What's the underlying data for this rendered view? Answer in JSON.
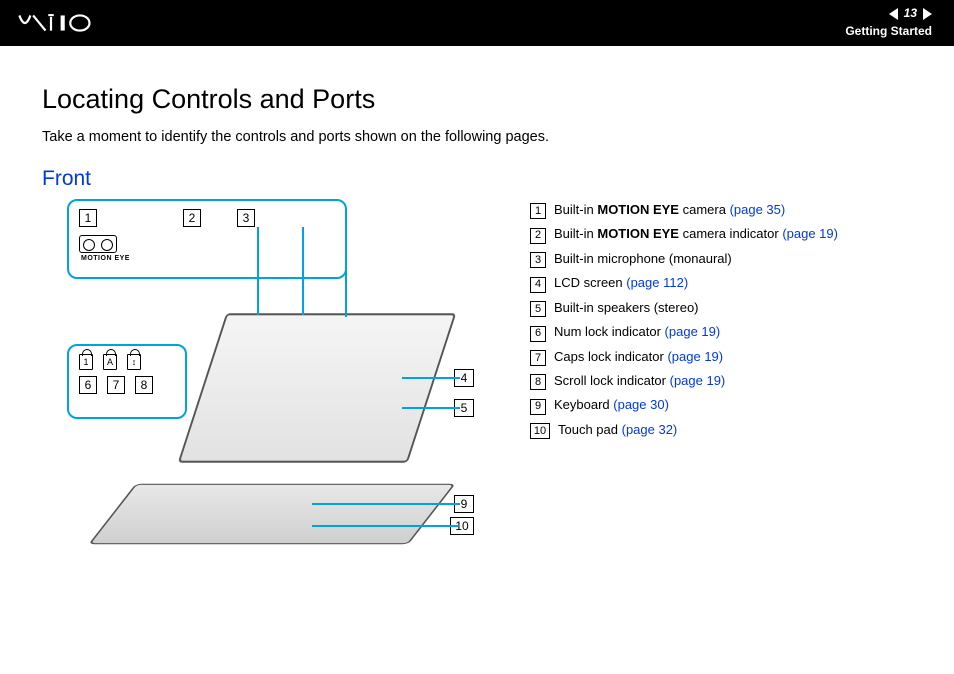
{
  "header": {
    "page_number": "13",
    "section": "Getting Started"
  },
  "title": "Locating Controls and Ports",
  "intro": "Take a moment to identify the controls and ports shown on the following pages.",
  "subheading": "Front",
  "diagram": {
    "callout_a_numbers": [
      "1",
      "2",
      "3"
    ],
    "motion_eye_label": "MOTION EYE",
    "callout_b_locks": [
      "1",
      "A",
      "↕"
    ],
    "callout_b_numbers": [
      "6",
      "7",
      "8"
    ],
    "side_numbers": {
      "n4": "4",
      "n5": "5",
      "n9": "9",
      "n10": "10"
    }
  },
  "legend": [
    {
      "num": "1",
      "prefix": "Built-in ",
      "bold": "MOTION EYE",
      "suffix": " camera ",
      "link": "(page 35)"
    },
    {
      "num": "2",
      "prefix": "Built-in ",
      "bold": "MOTION EYE",
      "suffix": " camera indicator ",
      "link": "(page 19)"
    },
    {
      "num": "3",
      "prefix": "Built-in microphone (monaural)",
      "bold": "",
      "suffix": "",
      "link": ""
    },
    {
      "num": "4",
      "prefix": "LCD screen ",
      "bold": "",
      "suffix": "",
      "link": "(page 112)"
    },
    {
      "num": "5",
      "prefix": "Built-in speakers (stereo)",
      "bold": "",
      "suffix": "",
      "link": ""
    },
    {
      "num": "6",
      "prefix": "Num lock indicator ",
      "bold": "",
      "suffix": "",
      "link": "(page 19)"
    },
    {
      "num": "7",
      "prefix": "Caps lock indicator ",
      "bold": "",
      "suffix": "",
      "link": "(page 19)"
    },
    {
      "num": "8",
      "prefix": "Scroll lock indicator ",
      "bold": "",
      "suffix": "",
      "link": "(page 19)"
    },
    {
      "num": "9",
      "prefix": "Keyboard ",
      "bold": "",
      "suffix": "",
      "link": "(page 30)"
    },
    {
      "num": "10",
      "prefix": "Touch pad ",
      "bold": "",
      "suffix": "",
      "link": "(page 32)"
    }
  ]
}
